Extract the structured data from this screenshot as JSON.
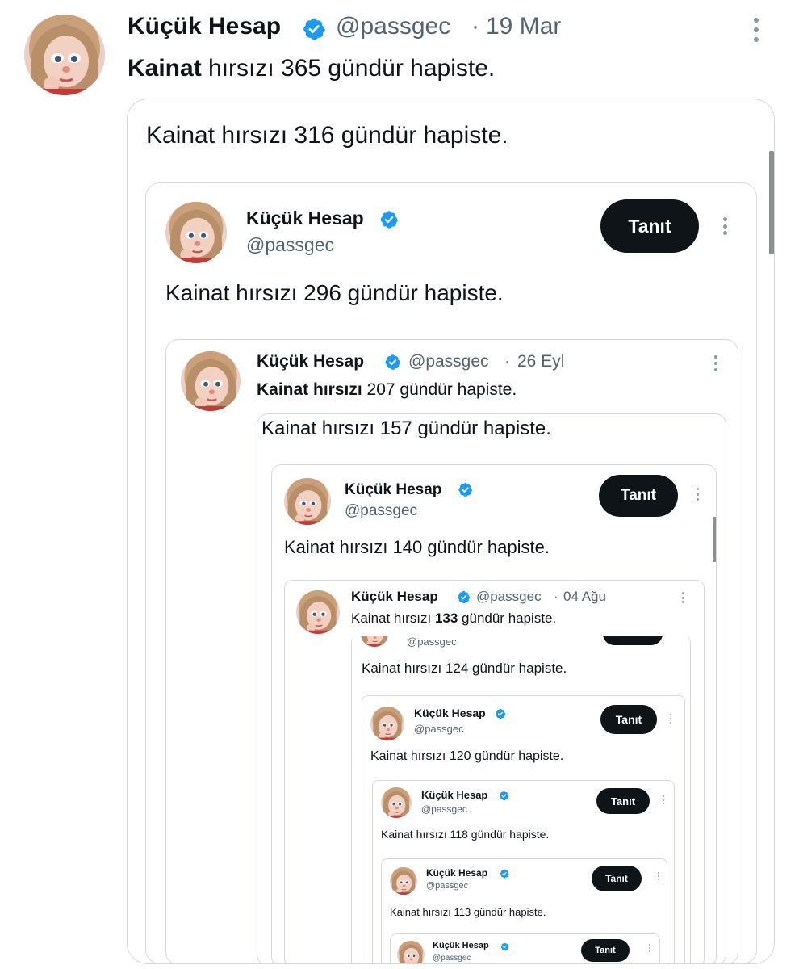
{
  "tweet": {
    "name": "Küçük Hesap",
    "handle": "@passgec",
    "separator": "·",
    "date": "19 Mar",
    "text_bold": "Kainat",
    "text_rest": " hırsızı 365 gündür hapiste."
  },
  "level1": {
    "text": "Kainat hırsızı 316 gündür hapiste."
  },
  "level2": {
    "name": "Küçük Hesap",
    "handle": "@passgec",
    "button": "Tanıt",
    "text": "Kainat hırsızı 296 gündür hapiste."
  },
  "level3": {
    "name": "Küçük Hesap",
    "handle": "@passgec",
    "separator": "·",
    "date": "26 Eyl",
    "text_bold": "Kainat hırsızı",
    "text_rest": " 207 gündür hapiste."
  },
  "level4": {
    "text": "Kainat hırsızı 157 gündür hapiste."
  },
  "level5": {
    "name": "Küçük Hesap",
    "handle": "@passgec",
    "button": "Tanıt",
    "text": "Kainat hırsızı 140 gündür hapiste."
  },
  "level6": {
    "name": "Küçük Hesap",
    "handle": "@passgec",
    "separator": "·",
    "date": "04 Ağu",
    "text_pre": "Kainat hırsızı ",
    "text_bold": "133",
    "text_rest": " gündür hapiste."
  },
  "level7": {
    "handle": "@passgec",
    "text": "Kainat hırsızı 124 gündür hapiste."
  },
  "level8": {
    "name": "Küçük Hesap",
    "handle": "@passgec",
    "button": "Tanıt",
    "text": "Kainat hırsızı 120 gündür hapiste."
  },
  "level9": {
    "name": "Küçük Hesap",
    "handle": "@passgec",
    "button": "Tanıt",
    "text": "Kainat hırsızı 118 gündür hapiste."
  },
  "level10": {
    "name": "Küçük Hesap",
    "handle": "@passgec",
    "button": "Tanıt",
    "text": "Kainat hırsızı 113 gündür hapiste."
  },
  "level11": {
    "name": "Küçük Hesap",
    "handle": "@passgec",
    "button": "Tanıt"
  },
  "colors": {
    "verified": "#1d9bf0",
    "button": "#0f1419",
    "handle": "#536471",
    "border": "#d5d9dd"
  },
  "icons": {
    "verified": "verified-badge-icon",
    "more": "more-vertical-icon",
    "avatar": "avatar-image"
  }
}
